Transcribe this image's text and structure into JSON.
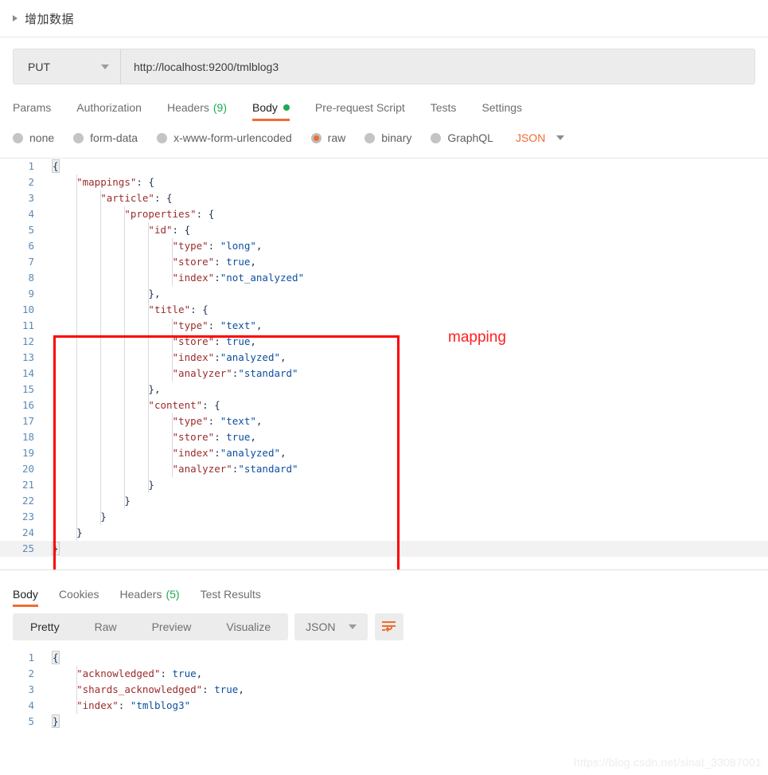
{
  "section": {
    "title": "增加数据",
    "expander_icon": "triangle-right-icon"
  },
  "request": {
    "method": "PUT",
    "method_caret_icon": "chevron-down-icon",
    "url": "http://localhost:9200/tmlblog3",
    "tabs": [
      {
        "label": "Params",
        "count": "",
        "active": false,
        "dot": false
      },
      {
        "label": "Authorization",
        "count": "",
        "active": false,
        "dot": false
      },
      {
        "label": "Headers",
        "count": "(9)",
        "active": false,
        "dot": false
      },
      {
        "label": "Body",
        "count": "",
        "active": true,
        "dot": true
      },
      {
        "label": "Pre-request Script",
        "count": "",
        "active": false,
        "dot": false
      },
      {
        "label": "Tests",
        "count": "",
        "active": false,
        "dot": false
      },
      {
        "label": "Settings",
        "count": "",
        "active": false,
        "dot": false
      }
    ],
    "body_types": [
      {
        "label": "none",
        "selected": false
      },
      {
        "label": "form-data",
        "selected": false
      },
      {
        "label": "x-www-form-urlencoded",
        "selected": false
      },
      {
        "label": "raw",
        "selected": true
      },
      {
        "label": "binary",
        "selected": false
      },
      {
        "label": "GraphQL",
        "selected": false
      }
    ],
    "raw_format": "JSON",
    "raw_format_caret_icon": "chevron-down-icon",
    "body_lines": [
      {
        "n": "1",
        "text": "{"
      },
      {
        "n": "2",
        "text": "    \"mappings\": {"
      },
      {
        "n": "3",
        "text": "        \"article\": {"
      },
      {
        "n": "4",
        "text": "            \"properties\": {"
      },
      {
        "n": "5",
        "text": "                \"id\": {"
      },
      {
        "n": "6",
        "text": "                    \"type\": \"long\","
      },
      {
        "n": "7",
        "text": "                    \"store\": true,"
      },
      {
        "n": "8",
        "text": "                    \"index\":\"not_analyzed\""
      },
      {
        "n": "9",
        "text": "                },"
      },
      {
        "n": "10",
        "text": "                \"title\": {"
      },
      {
        "n": "11",
        "text": "                    \"type\": \"text\","
      },
      {
        "n": "12",
        "text": "                    \"store\": true,"
      },
      {
        "n": "13",
        "text": "                    \"index\":\"analyzed\","
      },
      {
        "n": "14",
        "text": "                    \"analyzer\":\"standard\""
      },
      {
        "n": "15",
        "text": "                },"
      },
      {
        "n": "16",
        "text": "                \"content\": {"
      },
      {
        "n": "17",
        "text": "                    \"type\": \"text\","
      },
      {
        "n": "18",
        "text": "                    \"store\": true,"
      },
      {
        "n": "19",
        "text": "                    \"index\":\"analyzed\","
      },
      {
        "n": "20",
        "text": "                    \"analyzer\":\"standard\""
      },
      {
        "n": "21",
        "text": "                }"
      },
      {
        "n": "22",
        "text": "            }"
      },
      {
        "n": "23",
        "text": "        }"
      },
      {
        "n": "24",
        "text": "    }"
      },
      {
        "n": "25",
        "text": "}"
      }
    ]
  },
  "annotation": {
    "label": "mapping",
    "color": "#ff0000"
  },
  "response": {
    "tabs": [
      {
        "label": "Body",
        "count": "",
        "active": true
      },
      {
        "label": "Cookies",
        "count": "",
        "active": false
      },
      {
        "label": "Headers",
        "count": "(5)",
        "active": false
      },
      {
        "label": "Test Results",
        "count": "",
        "active": false
      }
    ],
    "view_modes": [
      {
        "label": "Pretty",
        "active": true
      },
      {
        "label": "Raw",
        "active": false
      },
      {
        "label": "Preview",
        "active": false
      },
      {
        "label": "Visualize",
        "active": false
      }
    ],
    "format": "JSON",
    "format_caret_icon": "chevron-down-icon",
    "wrap_icon": "word-wrap-icon",
    "body_lines": [
      {
        "n": "1",
        "text": "{"
      },
      {
        "n": "2",
        "text": "    \"acknowledged\": true,"
      },
      {
        "n": "3",
        "text": "    \"shards_acknowledged\": true,"
      },
      {
        "n": "4",
        "text": "    \"index\": \"tmlblog3\""
      },
      {
        "n": "5",
        "text": "}"
      }
    ]
  },
  "watermark": "https://blog.csdn.net/sinat_33087001"
}
